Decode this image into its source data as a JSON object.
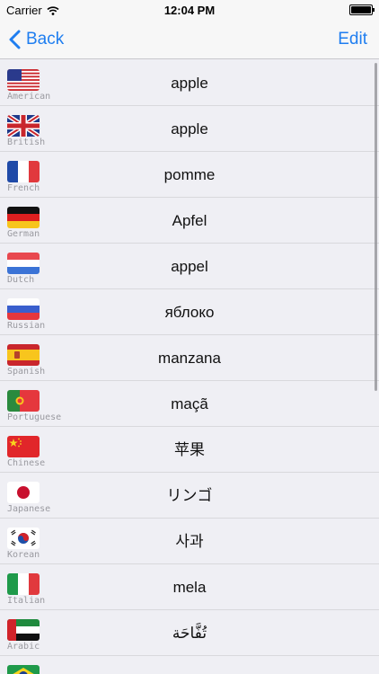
{
  "status": {
    "carrier": "Carrier",
    "time": "12:04 PM"
  },
  "nav": {
    "back_label": "Back",
    "edit_label": "Edit"
  },
  "rows": [
    {
      "language": "American",
      "word": "apple",
      "flag": "us"
    },
    {
      "language": "British",
      "word": "apple",
      "flag": "gb"
    },
    {
      "language": "French",
      "word": "pomme",
      "flag": "fr"
    },
    {
      "language": "German",
      "word": "Apfel",
      "flag": "de"
    },
    {
      "language": "Dutch",
      "word": "appel",
      "flag": "nl"
    },
    {
      "language": "Russian",
      "word": "яблоко",
      "flag": "ru"
    },
    {
      "language": "Spanish",
      "word": "manzana",
      "flag": "es"
    },
    {
      "language": "Portuguese",
      "word": "maçã",
      "flag": "pt"
    },
    {
      "language": "Chinese",
      "word": "苹果",
      "flag": "cn"
    },
    {
      "language": "Japanese",
      "word": "リンゴ",
      "flag": "jp"
    },
    {
      "language": "Korean",
      "word": "사과",
      "flag": "kr"
    },
    {
      "language": "Italian",
      "word": "mela",
      "flag": "it"
    },
    {
      "language": "Arabic",
      "word": "تُفَّاحَة",
      "flag": "ae"
    },
    {
      "language": "",
      "word": "",
      "flag": "br"
    }
  ],
  "colors": {
    "accent": "#1f7ef0",
    "separator": "#d8d8dc",
    "language_label": "#9a9aa0"
  }
}
